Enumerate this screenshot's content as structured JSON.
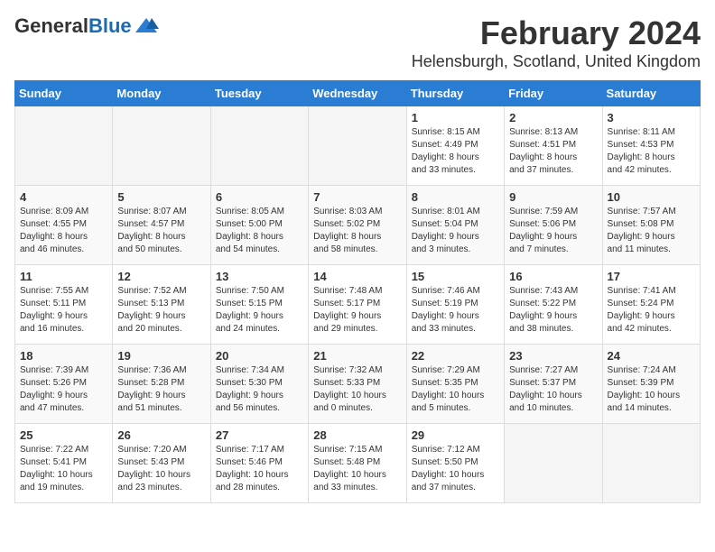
{
  "header": {
    "logo_general": "General",
    "logo_blue": "Blue",
    "title": "February 2024",
    "subtitle": "Helensburgh, Scotland, United Kingdom"
  },
  "calendar": {
    "days_of_week": [
      "Sunday",
      "Monday",
      "Tuesday",
      "Wednesday",
      "Thursday",
      "Friday",
      "Saturday"
    ],
    "weeks": [
      [
        {
          "day": "",
          "info": ""
        },
        {
          "day": "",
          "info": ""
        },
        {
          "day": "",
          "info": ""
        },
        {
          "day": "",
          "info": ""
        },
        {
          "day": "1",
          "info": "Sunrise: 8:15 AM\nSunset: 4:49 PM\nDaylight: 8 hours\nand 33 minutes."
        },
        {
          "day": "2",
          "info": "Sunrise: 8:13 AM\nSunset: 4:51 PM\nDaylight: 8 hours\nand 37 minutes."
        },
        {
          "day": "3",
          "info": "Sunrise: 8:11 AM\nSunset: 4:53 PM\nDaylight: 8 hours\nand 42 minutes."
        }
      ],
      [
        {
          "day": "4",
          "info": "Sunrise: 8:09 AM\nSunset: 4:55 PM\nDaylight: 8 hours\nand 46 minutes."
        },
        {
          "day": "5",
          "info": "Sunrise: 8:07 AM\nSunset: 4:57 PM\nDaylight: 8 hours\nand 50 minutes."
        },
        {
          "day": "6",
          "info": "Sunrise: 8:05 AM\nSunset: 5:00 PM\nDaylight: 8 hours\nand 54 minutes."
        },
        {
          "day": "7",
          "info": "Sunrise: 8:03 AM\nSunset: 5:02 PM\nDaylight: 8 hours\nand 58 minutes."
        },
        {
          "day": "8",
          "info": "Sunrise: 8:01 AM\nSunset: 5:04 PM\nDaylight: 9 hours\nand 3 minutes."
        },
        {
          "day": "9",
          "info": "Sunrise: 7:59 AM\nSunset: 5:06 PM\nDaylight: 9 hours\nand 7 minutes."
        },
        {
          "day": "10",
          "info": "Sunrise: 7:57 AM\nSunset: 5:08 PM\nDaylight: 9 hours\nand 11 minutes."
        }
      ],
      [
        {
          "day": "11",
          "info": "Sunrise: 7:55 AM\nSunset: 5:11 PM\nDaylight: 9 hours\nand 16 minutes."
        },
        {
          "day": "12",
          "info": "Sunrise: 7:52 AM\nSunset: 5:13 PM\nDaylight: 9 hours\nand 20 minutes."
        },
        {
          "day": "13",
          "info": "Sunrise: 7:50 AM\nSunset: 5:15 PM\nDaylight: 9 hours\nand 24 minutes."
        },
        {
          "day": "14",
          "info": "Sunrise: 7:48 AM\nSunset: 5:17 PM\nDaylight: 9 hours\nand 29 minutes."
        },
        {
          "day": "15",
          "info": "Sunrise: 7:46 AM\nSunset: 5:19 PM\nDaylight: 9 hours\nand 33 minutes."
        },
        {
          "day": "16",
          "info": "Sunrise: 7:43 AM\nSunset: 5:22 PM\nDaylight: 9 hours\nand 38 minutes."
        },
        {
          "day": "17",
          "info": "Sunrise: 7:41 AM\nSunset: 5:24 PM\nDaylight: 9 hours\nand 42 minutes."
        }
      ],
      [
        {
          "day": "18",
          "info": "Sunrise: 7:39 AM\nSunset: 5:26 PM\nDaylight: 9 hours\nand 47 minutes."
        },
        {
          "day": "19",
          "info": "Sunrise: 7:36 AM\nSunset: 5:28 PM\nDaylight: 9 hours\nand 51 minutes."
        },
        {
          "day": "20",
          "info": "Sunrise: 7:34 AM\nSunset: 5:30 PM\nDaylight: 9 hours\nand 56 minutes."
        },
        {
          "day": "21",
          "info": "Sunrise: 7:32 AM\nSunset: 5:33 PM\nDaylight: 10 hours\nand 0 minutes."
        },
        {
          "day": "22",
          "info": "Sunrise: 7:29 AM\nSunset: 5:35 PM\nDaylight: 10 hours\nand 5 minutes."
        },
        {
          "day": "23",
          "info": "Sunrise: 7:27 AM\nSunset: 5:37 PM\nDaylight: 10 hours\nand 10 minutes."
        },
        {
          "day": "24",
          "info": "Sunrise: 7:24 AM\nSunset: 5:39 PM\nDaylight: 10 hours\nand 14 minutes."
        }
      ],
      [
        {
          "day": "25",
          "info": "Sunrise: 7:22 AM\nSunset: 5:41 PM\nDaylight: 10 hours\nand 19 minutes."
        },
        {
          "day": "26",
          "info": "Sunrise: 7:20 AM\nSunset: 5:43 PM\nDaylight: 10 hours\nand 23 minutes."
        },
        {
          "day": "27",
          "info": "Sunrise: 7:17 AM\nSunset: 5:46 PM\nDaylight: 10 hours\nand 28 minutes."
        },
        {
          "day": "28",
          "info": "Sunrise: 7:15 AM\nSunset: 5:48 PM\nDaylight: 10 hours\nand 33 minutes."
        },
        {
          "day": "29",
          "info": "Sunrise: 7:12 AM\nSunset: 5:50 PM\nDaylight: 10 hours\nand 37 minutes."
        },
        {
          "day": "",
          "info": ""
        },
        {
          "day": "",
          "info": ""
        }
      ]
    ]
  }
}
